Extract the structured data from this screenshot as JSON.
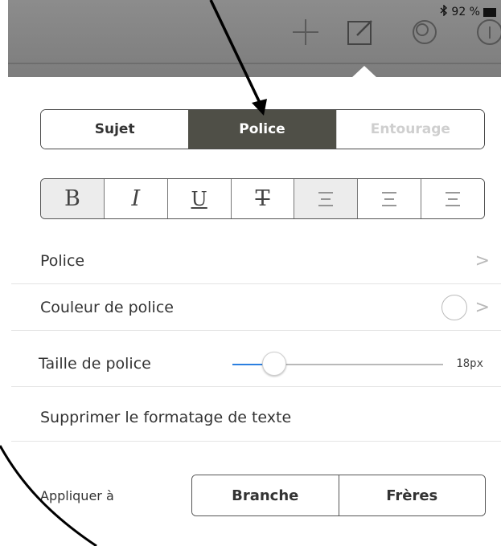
{
  "status_bar": {
    "battery_text": "92 %",
    "icons": [
      "bluetooth-icon",
      "battery-icon"
    ]
  },
  "toolbar": {
    "icons": [
      "add-icon",
      "edit-frame-icon",
      "style-icon",
      "info-icon"
    ]
  },
  "tabs": [
    {
      "label": "Sujet",
      "state": "normal"
    },
    {
      "label": "Police",
      "state": "active"
    },
    {
      "label": "Entourage",
      "state": "disabled"
    }
  ],
  "format_buttons": [
    {
      "glyph": "B",
      "name": "bold",
      "selected": true
    },
    {
      "glyph": "I",
      "name": "italic",
      "selected": false
    },
    {
      "glyph": "U",
      "name": "underline",
      "selected": false
    },
    {
      "glyph": "T",
      "name": "strikethrough",
      "selected": false
    },
    {
      "glyph": "",
      "name": "align-left",
      "selected": true
    },
    {
      "glyph": "",
      "name": "align-center",
      "selected": false
    },
    {
      "glyph": "",
      "name": "align-right",
      "selected": false
    }
  ],
  "rows": {
    "font": {
      "label": "Police",
      "chevron": ">"
    },
    "font_color": {
      "label": "Couleur de police",
      "chevron": ">",
      "swatch_color": "#ffffff"
    },
    "font_size": {
      "label": "Taille de police",
      "value": "18px",
      "slider_fraction": 0.2
    },
    "clear_format": {
      "label": "Supprimer le formatage de texte"
    }
  },
  "apply": {
    "label": "Appliquer à",
    "options": [
      "Branche",
      "Frères"
    ]
  },
  "colors": {
    "active_tab": "#4f4f47",
    "slider_fill": "#2b7fe0",
    "toolbar_bg": "#858585"
  }
}
